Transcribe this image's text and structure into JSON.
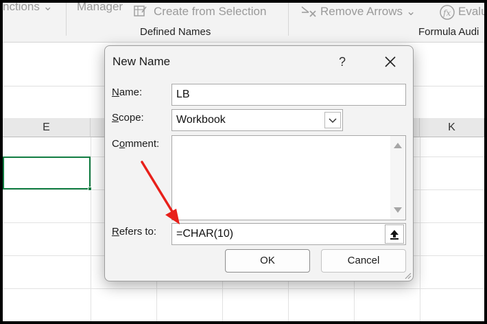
{
  "ribbon": {
    "functions_partial": "nctions",
    "manager_partial": "Manager",
    "create_from_selection": "Create from Selection",
    "remove_arrows": "Remove Arrows",
    "evaluate_partial": "Evalu",
    "defined_names_group": "Defined Names",
    "formula_auditing_partial": "Formula Audi",
    "fx_glyph": "fx"
  },
  "grid": {
    "col_e": "E",
    "col_k": "K"
  },
  "dialog": {
    "title": "New Name",
    "help": "?",
    "name_label_ul": "N",
    "name_label_rest": "ame:",
    "name_value": "LB",
    "scope_label_ul": "S",
    "scope_label_rest": "cope:",
    "scope_value": "Workbook",
    "comment_label_pre": "C",
    "comment_label_ul": "o",
    "comment_label_rest": "mment:",
    "refers_label_ul": "R",
    "refers_label_rest": "efers to:",
    "refers_value": "=CHAR(10)",
    "ok": "OK",
    "cancel": "Cancel"
  },
  "colors": {
    "selection_border": "#107c41",
    "annotation_arrow": "#e8201a"
  },
  "icons": [
    "create-from-selection-icon",
    "remove-arrows-icon",
    "evaluate-formula-icon",
    "close-icon",
    "chevron-down-icon",
    "collapse-dialog-icon",
    "resize-grip-icon"
  ]
}
